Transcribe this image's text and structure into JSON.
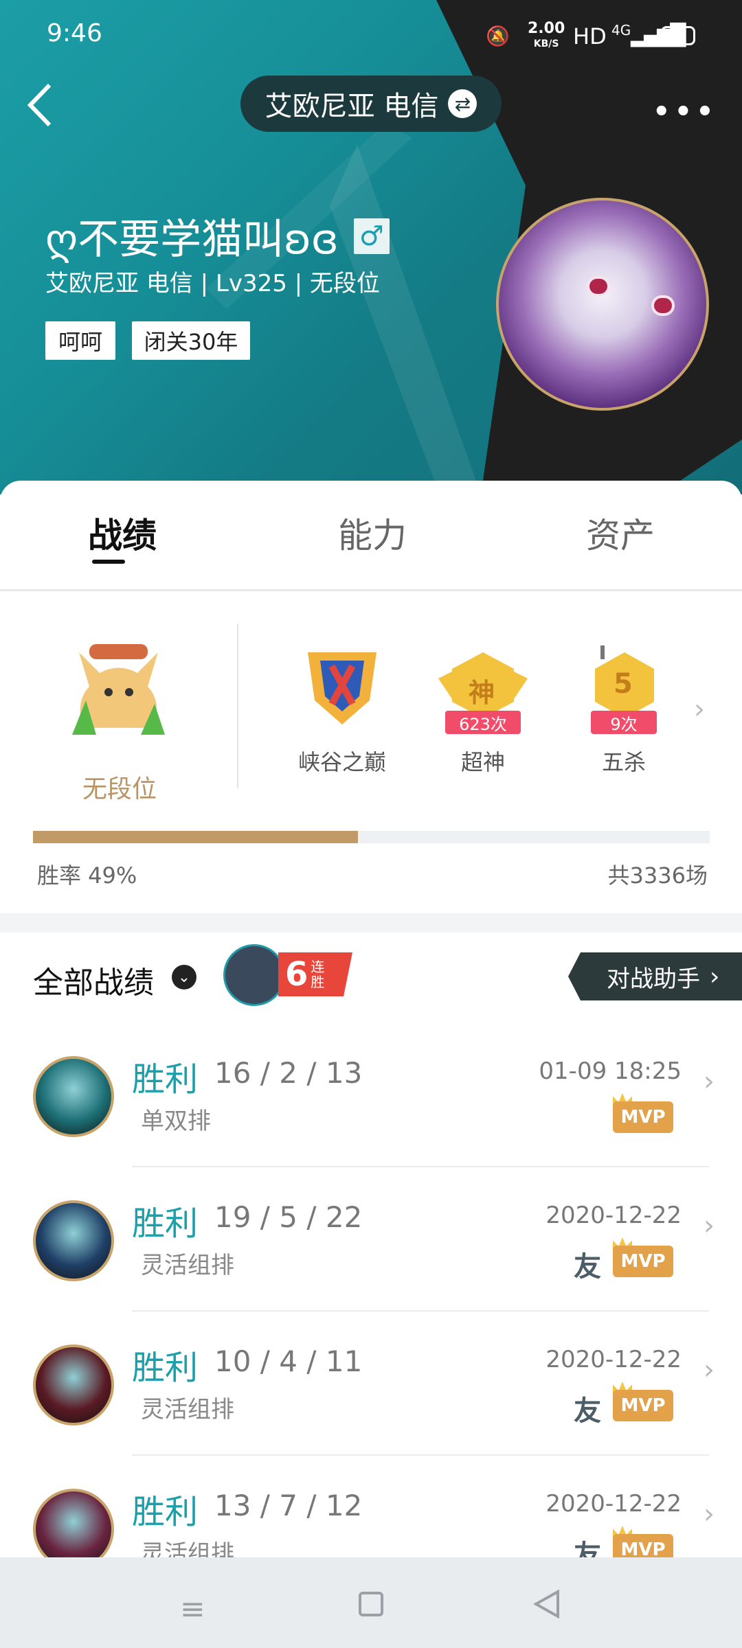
{
  "status_bar": {
    "time": "9:46",
    "speed": "2.00",
    "speed_unit": "KB/S",
    "hd": "HD",
    "network": "4G",
    "battery": "50"
  },
  "nav": {
    "back_icon": "chevron-left-icon",
    "server": "艾欧尼亚 电信",
    "swap_icon": "swap-icon",
    "more_icon": "more-dots-icon"
  },
  "profile": {
    "nickname": "ღ不要学猫叫ʚɞ",
    "gender_icon": "male-icon",
    "gender_symbol": "♂",
    "subline": "艾欧尼亚 电信 | Lv325 | 无段位",
    "tags": [
      "呵呵",
      "闭关30年"
    ]
  },
  "tabs": [
    "战绩",
    "能力",
    "资产"
  ],
  "summary": {
    "rank_label": "无段位",
    "badges": [
      {
        "label": "峡谷之巅",
        "count": ""
      },
      {
        "label": "超神",
        "count": "623次",
        "glyph": "神"
      },
      {
        "label": "五杀",
        "count": "9次",
        "glyph": "5"
      }
    ],
    "win_rate_label": "胜率  49%",
    "win_rate": 0.49,
    "total": "共3336场"
  },
  "records": {
    "title": "全部战绩",
    "streak": "6",
    "streak_text": "连胜",
    "assistant": "对战助手"
  },
  "matches": [
    {
      "result": "胜利",
      "kda": "16 / 2 / 13",
      "mode": "单双排",
      "date": "01-09 18:25",
      "mvp": "MVP",
      "friend": ""
    },
    {
      "result": "胜利",
      "kda": "19 / 5 / 22",
      "mode": "灵活组排",
      "date": "2020-12-22",
      "mvp": "MVP",
      "friend": "友"
    },
    {
      "result": "胜利",
      "kda": "10 / 4 / 11",
      "mode": "灵活组排",
      "date": "2020-12-22",
      "mvp": "MVP",
      "friend": "友"
    },
    {
      "result": "胜利",
      "kda": "13 / 7 / 12",
      "mode": "灵活组排",
      "date": "2020-12-22",
      "mvp": "MVP",
      "friend": "友"
    }
  ]
}
